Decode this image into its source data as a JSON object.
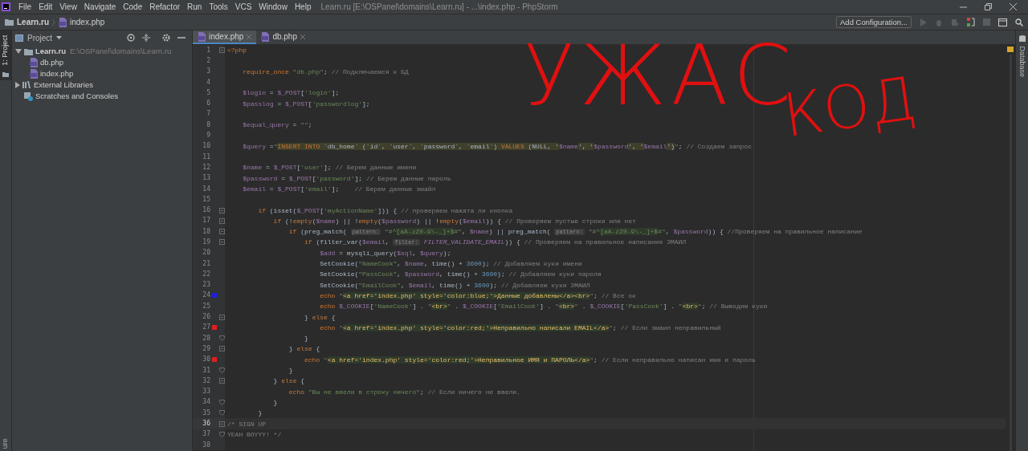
{
  "window": {
    "title": "Learn.ru [E:\\OSPanel\\domains\\Learn.ru] - ...\\index.php - PhpStorm"
  },
  "menu": [
    "File",
    "Edit",
    "View",
    "Navigate",
    "Code",
    "Refactor",
    "Run",
    "Tools",
    "VCS",
    "Window",
    "Help"
  ],
  "breadcrumbs": [
    {
      "label": "Learn.ru",
      "kind": "folder"
    },
    {
      "label": "index.php",
      "kind": "php"
    }
  ],
  "toolbar": {
    "run_config": "Add Configuration..."
  },
  "left_strip": [
    {
      "label": "1: Project",
      "selected": true
    },
    {
      "label": "ure",
      "selected": false
    }
  ],
  "right_strip": [
    {
      "label": "Database"
    }
  ],
  "project_panel": {
    "title": "Project",
    "tree": [
      {
        "label": "Learn.ru",
        "path": "E:\\OSPanel\\domains\\Learn.ru",
        "kind": "folder",
        "expanded": true,
        "children": [
          {
            "label": "db.php",
            "kind": "php"
          },
          {
            "label": "index.php",
            "kind": "php"
          }
        ]
      },
      {
        "label": "External Libraries",
        "kind": "library",
        "expanded": false
      },
      {
        "label": "Scratches and Consoles",
        "kind": "scratch"
      }
    ]
  },
  "editor_tabs": [
    {
      "label": "index.php",
      "selected": true
    },
    {
      "label": "db.php",
      "selected": false
    }
  ],
  "editor": {
    "lines": [
      {
        "number": "1",
        "kind": "fold_start",
        "current": false,
        "tokens": [
          {
            "kind": "kw",
            "text": "<?php"
          }
        ]
      },
      {
        "number": "2",
        "kind": "plain",
        "current": false
      },
      {
        "number": "3",
        "kind": "plain",
        "current": false,
        "tokens": [
          {
            "kind": "kw",
            "text": "    require_once"
          },
          {
            "kind": "str",
            "text": " \"db.php\""
          },
          {
            "kind": "p",
            "text": ";"
          },
          {
            "kind": "cmt",
            "text": " // Подключаемся к БД"
          }
        ]
      },
      {
        "number": "4",
        "kind": "plain",
        "current": false
      },
      {
        "number": "5",
        "kind": "plain",
        "current": false,
        "tokens": [
          {
            "kind": "var",
            "text": "    $login"
          },
          {
            "kind": "p",
            "text": " ="
          },
          {
            "kind": "var",
            "text": " $_POST"
          },
          {
            "kind": "p",
            "text": "["
          },
          {
            "kind": "str",
            "text": "'login'"
          },
          {
            "kind": "p",
            "text": "];"
          }
        ]
      },
      {
        "number": "6",
        "kind": "plain",
        "current": false,
        "tokens": [
          {
            "kind": "var",
            "text": "    $passlog"
          },
          {
            "kind": "p",
            "text": " ="
          },
          {
            "kind": "var",
            "text": " $_POST"
          },
          {
            "kind": "p",
            "text": "["
          },
          {
            "kind": "str",
            "text": "'passwordlog'"
          },
          {
            "kind": "p",
            "text": "];"
          }
        ]
      },
      {
        "number": "7",
        "kind": "plain",
        "current": false
      },
      {
        "number": "8",
        "kind": "plain",
        "current": false,
        "tokens": [
          {
            "kind": "var",
            "text": "    $equal_query"
          },
          {
            "kind": "p",
            "text": " ="
          },
          {
            "kind": "str",
            "text": " \"\""
          },
          {
            "kind": "p",
            "text": ";"
          }
        ]
      },
      {
        "number": "9",
        "kind": "plain",
        "current": false
      },
      {
        "number": "10",
        "kind": "plain",
        "current": false,
        "tokens": [
          {
            "kind": "var",
            "text": "    $query"
          },
          {
            "kind": "p",
            "text": " ="
          },
          {
            "kind": "str",
            "text": "\""
          },
          {
            "kind": "sqlkw",
            "text": "INSERT INTO"
          },
          {
            "kind": "sql",
            "text": " `db_home` (`id`, `user`, `password`, `email`) "
          },
          {
            "kind": "sqlkw",
            "text": "VALUES"
          },
          {
            "kind": "sql",
            "text": " (NULL, '"
          },
          {
            "kind": "var",
            "text": "$name"
          },
          {
            "kind": "sql",
            "text": "', '"
          },
          {
            "kind": "var",
            "text": "$password"
          },
          {
            "kind": "sql",
            "text": "', '"
          },
          {
            "kind": "var",
            "text": "$email"
          },
          {
            "kind": "sql",
            "text": "')"
          },
          {
            "kind": "str",
            "text": "\""
          },
          {
            "kind": "p",
            "text": ";"
          },
          {
            "kind": "cmt",
            "text": " // Создаем запрос"
          }
        ]
      },
      {
        "number": "11",
        "kind": "plain",
        "current": false
      },
      {
        "number": "12",
        "kind": "plain",
        "current": false,
        "tokens": [
          {
            "kind": "var",
            "text": "    $name"
          },
          {
            "kind": "p",
            "text": " ="
          },
          {
            "kind": "var",
            "text": " $_POST"
          },
          {
            "kind": "p",
            "text": "["
          },
          {
            "kind": "str",
            "text": "'user'"
          },
          {
            "kind": "p",
            "text": "];"
          },
          {
            "kind": "cmt",
            "text": " // Берем данные имени"
          }
        ]
      },
      {
        "number": "13",
        "kind": "plain",
        "current": false,
        "tokens": [
          {
            "kind": "var",
            "text": "    $password"
          },
          {
            "kind": "p",
            "text": " ="
          },
          {
            "kind": "var",
            "text": " $_POST"
          },
          {
            "kind": "p",
            "text": "["
          },
          {
            "kind": "str",
            "text": "'password'"
          },
          {
            "kind": "p",
            "text": "];"
          },
          {
            "kind": "cmt",
            "text": " // Берем данные пароль"
          }
        ]
      },
      {
        "number": "14",
        "kind": "plain",
        "current": false,
        "tokens": [
          {
            "kind": "var",
            "text": "    $email"
          },
          {
            "kind": "p",
            "text": " ="
          },
          {
            "kind": "var",
            "text": " $_POST"
          },
          {
            "kind": "p",
            "text": "["
          },
          {
            "kind": "str",
            "text": "'email'"
          },
          {
            "kind": "p",
            "text": "];"
          },
          {
            "kind": "cmt",
            "text": "    // Берем данные эмайл"
          }
        ]
      },
      {
        "number": "15",
        "kind": "plain",
        "current": false
      },
      {
        "number": "16",
        "kind": "fold_start",
        "current": false,
        "tokens": [
          {
            "kind": "kw",
            "text": "        if"
          },
          {
            "kind": "p",
            "text": " (isset("
          },
          {
            "kind": "var",
            "text": "$_POST"
          },
          {
            "kind": "p",
            "text": "["
          },
          {
            "kind": "str",
            "text": "'myActionName'"
          },
          {
            "kind": "p",
            "text": "])) {"
          },
          {
            "kind": "cmt",
            "text": " // проверяем нажата ли кнопка"
          }
        ]
      },
      {
        "number": "17",
        "kind": "fold_start",
        "current": false,
        "tokens": [
          {
            "kind": "kw",
            "text": "            if"
          },
          {
            "kind": "p",
            "text": " (!"
          },
          {
            "kind": "kw",
            "text": "empty"
          },
          {
            "kind": "p",
            "text": "("
          },
          {
            "kind": "var",
            "text": "$name"
          },
          {
            "kind": "p",
            "text": ") || !"
          },
          {
            "kind": "kw",
            "text": "empty"
          },
          {
            "kind": "p",
            "text": "("
          },
          {
            "kind": "var",
            "text": "$password"
          },
          {
            "kind": "p",
            "text": ") || !"
          },
          {
            "kind": "kw",
            "text": "empty"
          },
          {
            "kind": "p",
            "text": "("
          },
          {
            "kind": "var",
            "text": "$email"
          },
          {
            "kind": "p",
            "text": ")) {"
          },
          {
            "kind": "cmt",
            "text": " // Проверяем пустые строки или нет"
          }
        ]
      },
      {
        "number": "18",
        "kind": "fold_start",
        "current": false,
        "tokens": [
          {
            "kind": "kw",
            "text": "                if"
          },
          {
            "kind": "p",
            "text": " (preg_match( "
          },
          {
            "kind": "hint",
            "text": "pattern:"
          },
          {
            "kind": "str",
            "text": " \"#^"
          },
          {
            "kind": "re",
            "text": "[aA-zZ0-9\\-_]+$"
          },
          {
            "kind": "str",
            "text": "#\""
          },
          {
            "kind": "p",
            "text": ", "
          },
          {
            "kind": "var",
            "text": "$name"
          },
          {
            "kind": "p",
            "text": ") || preg_match( "
          },
          {
            "kind": "hint",
            "text": "pattern:"
          },
          {
            "kind": "str",
            "text": " \"#^"
          },
          {
            "kind": "re",
            "text": "[aA-zZ0-9\\-_]+$"
          },
          {
            "kind": "str",
            "text": "#\""
          },
          {
            "kind": "p",
            "text": ", "
          },
          {
            "kind": "var",
            "text": "$password"
          },
          {
            "kind": "p",
            "text": ")) {"
          },
          {
            "kind": "cmt",
            "text": " //Проверяем на правильное написание"
          }
        ]
      },
      {
        "number": "19",
        "kind": "fold_start",
        "current": false,
        "tokens": [
          {
            "kind": "kw",
            "text": "                    if"
          },
          {
            "kind": "p",
            "text": " (filter_var("
          },
          {
            "kind": "var",
            "text": "$email"
          },
          {
            "kind": "p",
            "text": ", "
          },
          {
            "kind": "hint",
            "text": "filter:"
          },
          {
            "kind": "const",
            "text": " FILTER_VALIDATE_EMAIL"
          },
          {
            "kind": "p",
            "text": ")) {"
          },
          {
            "kind": "cmt",
            "text": " // Проверяем на правильное написания ЭМАИЛ"
          }
        ]
      },
      {
        "number": "20",
        "kind": "plain",
        "current": false,
        "tokens": [
          {
            "kind": "var",
            "text": "                        $add"
          },
          {
            "kind": "p",
            "text": " = mysqli_query("
          },
          {
            "kind": "var",
            "text": "$sql"
          },
          {
            "kind": "p",
            "text": ", "
          },
          {
            "kind": "var",
            "text": "$query"
          },
          {
            "kind": "p",
            "text": ");"
          }
        ]
      },
      {
        "number": "21",
        "kind": "plain",
        "current": false,
        "tokens": [
          {
            "kind": "p",
            "text": "                        SetCookie("
          },
          {
            "kind": "str",
            "text": "\"NameCook\""
          },
          {
            "kind": "p",
            "text": ", "
          },
          {
            "kind": "var",
            "text": "$name"
          },
          {
            "kind": "p",
            "text": ", time() +"
          },
          {
            "kind": "num",
            "text": " 3600"
          },
          {
            "kind": "p",
            "text": ");"
          },
          {
            "kind": "cmt",
            "text": " // Добавляем куки имени"
          }
        ]
      },
      {
        "number": "22",
        "kind": "plain",
        "current": false,
        "tokens": [
          {
            "kind": "p",
            "text": "                        SetCookie("
          },
          {
            "kind": "str",
            "text": "\"PassCook\""
          },
          {
            "kind": "p",
            "text": ", "
          },
          {
            "kind": "var",
            "text": "$password"
          },
          {
            "kind": "p",
            "text": ", time() +"
          },
          {
            "kind": "num",
            "text": " 3600"
          },
          {
            "kind": "p",
            "text": ");"
          },
          {
            "kind": "cmt",
            "text": " // Добавляем куки пароля"
          }
        ]
      },
      {
        "number": "23",
        "kind": "plain",
        "current": false,
        "tokens": [
          {
            "kind": "p",
            "text": "                        SetCookie("
          },
          {
            "kind": "str",
            "text": "\"EmailCook\""
          },
          {
            "kind": "p",
            "text": ", "
          },
          {
            "kind": "var",
            "text": "$email"
          },
          {
            "kind": "p",
            "text": ", time() +"
          },
          {
            "kind": "num",
            "text": " 3600"
          },
          {
            "kind": "p",
            "text": ");"
          },
          {
            "kind": "cmt",
            "text": " // Добавляем куки ЭМАИЛ"
          }
        ]
      },
      {
        "number": "24",
        "kind": "plain",
        "color": "#1f1fe0",
        "current": false,
        "tokens": [
          {
            "kind": "kw",
            "text": "                        echo"
          },
          {
            "kind": "str",
            "text": " \""
          },
          {
            "kind": "html",
            "text": "<a href='index.php' style='color:blue;'>Данные добавлены</a><br>"
          },
          {
            "kind": "str",
            "text": "\""
          },
          {
            "kind": "p",
            "text": ";"
          },
          {
            "kind": "cmt",
            "text": " // Все ок"
          }
        ]
      },
      {
        "number": "25",
        "kind": "plain",
        "current": false,
        "tokens": [
          {
            "kind": "kw",
            "text": "                        echo"
          },
          {
            "kind": "var",
            "text": " $_COOKIE"
          },
          {
            "kind": "p",
            "text": "["
          },
          {
            "kind": "str",
            "text": "'NameCook'"
          },
          {
            "kind": "p",
            "text": "] ."
          },
          {
            "kind": "str",
            "text": " \""
          },
          {
            "kind": "html",
            "text": "<br>"
          },
          {
            "kind": "str",
            "text": "\""
          },
          {
            "kind": "p",
            "text": " ."
          },
          {
            "kind": "var",
            "text": " $_COOKIE"
          },
          {
            "kind": "p",
            "text": "["
          },
          {
            "kind": "str",
            "text": "'EmailCook'"
          },
          {
            "kind": "p",
            "text": "] ."
          },
          {
            "kind": "str",
            "text": " \""
          },
          {
            "kind": "html",
            "text": "<br>"
          },
          {
            "kind": "str",
            "text": "\""
          },
          {
            "kind": "p",
            "text": " ."
          },
          {
            "kind": "var",
            "text": " $_COOKIE"
          },
          {
            "kind": "p",
            "text": "["
          },
          {
            "kind": "str",
            "text": "'PassCook'"
          },
          {
            "kind": "p",
            "text": "] ."
          },
          {
            "kind": "str",
            "text": " \""
          },
          {
            "kind": "html",
            "text": "<br>"
          },
          {
            "kind": "str",
            "text": "\""
          },
          {
            "kind": "p",
            "text": ";"
          },
          {
            "kind": "cmt",
            "text": " // Выводим куки"
          }
        ]
      },
      {
        "number": "26",
        "kind": "fold_start",
        "current": false,
        "tokens": [
          {
            "kind": "p",
            "text": "                    }"
          },
          {
            "kind": "kw",
            "text": " else"
          },
          {
            "kind": "p",
            "text": " {"
          }
        ]
      },
      {
        "number": "27",
        "kind": "plain",
        "color": "#e01f1f",
        "current": false,
        "tokens": [
          {
            "kind": "kw",
            "text": "                        echo"
          },
          {
            "kind": "str",
            "text": " \""
          },
          {
            "kind": "html",
            "text": "<a href='index.php' style='color:red;'>Неправильно написали EMAIL</a>"
          },
          {
            "kind": "str",
            "text": "\""
          },
          {
            "kind": "p",
            "text": ";"
          },
          {
            "kind": "cmt",
            "text": " // Если эмаил неправильный"
          }
        ]
      },
      {
        "number": "28",
        "kind": "fold_end",
        "current": false,
        "tokens": [
          {
            "kind": "p",
            "text": "                    }"
          }
        ]
      },
      {
        "number": "29",
        "kind": "fold_start",
        "current": false,
        "tokens": [
          {
            "kind": "p",
            "text": "                }"
          },
          {
            "kind": "kw",
            "text": " else"
          },
          {
            "kind": "p",
            "text": " {"
          }
        ]
      },
      {
        "number": "30",
        "kind": "plain",
        "color": "#e01f1f",
        "current": false,
        "tokens": [
          {
            "kind": "kw",
            "text": "                    echo"
          },
          {
            "kind": "str",
            "text": " \""
          },
          {
            "kind": "html",
            "text": "<a href='index.php' style='color:red;'>Неправильное ИМЯ и ПАРОЛЬ</a>"
          },
          {
            "kind": "str",
            "text": "\""
          },
          {
            "kind": "p",
            "text": ";"
          },
          {
            "kind": "cmt",
            "text": " // Если неправильно написан имя и пароль"
          }
        ]
      },
      {
        "number": "31",
        "kind": "fold_end",
        "current": false,
        "tokens": [
          {
            "kind": "p",
            "text": "                }"
          }
        ]
      },
      {
        "number": "32",
        "kind": "fold_start",
        "current": false,
        "tokens": [
          {
            "kind": "p",
            "text": "            }"
          },
          {
            "kind": "kw",
            "text": " else"
          },
          {
            "kind": "p",
            "text": " {"
          }
        ]
      },
      {
        "number": "33",
        "kind": "plain",
        "current": false,
        "tokens": [
          {
            "kind": "kw",
            "text": "                echo"
          },
          {
            "kind": "str",
            "text": " \"Вы не ввели в строку ничего\""
          },
          {
            "kind": "p",
            "text": ";"
          },
          {
            "kind": "cmt",
            "text": " // Если ничего не ввели."
          }
        ]
      },
      {
        "number": "34",
        "kind": "fold_end",
        "current": false,
        "tokens": [
          {
            "kind": "p",
            "text": "            }"
          }
        ]
      },
      {
        "number": "35",
        "kind": "fold_end",
        "current": false,
        "tokens": [
          {
            "kind": "p",
            "text": "        }"
          }
        ]
      },
      {
        "number": "36",
        "kind": "fold_start",
        "current": true,
        "tokens": [
          {
            "kind": "cmt",
            "text": "/* SIGN UP"
          }
        ]
      },
      {
        "number": "37",
        "kind": "fold_end",
        "current": false,
        "tokens": [
          {
            "kind": "cmt",
            "text": "YEAH BOYYY! */"
          }
        ]
      },
      {
        "number": "38",
        "kind": "plain",
        "current": false
      }
    ]
  },
  "annotations": [
    {
      "text": "УЖАС"
    },
    {
      "text": "КОД"
    }
  ]
}
